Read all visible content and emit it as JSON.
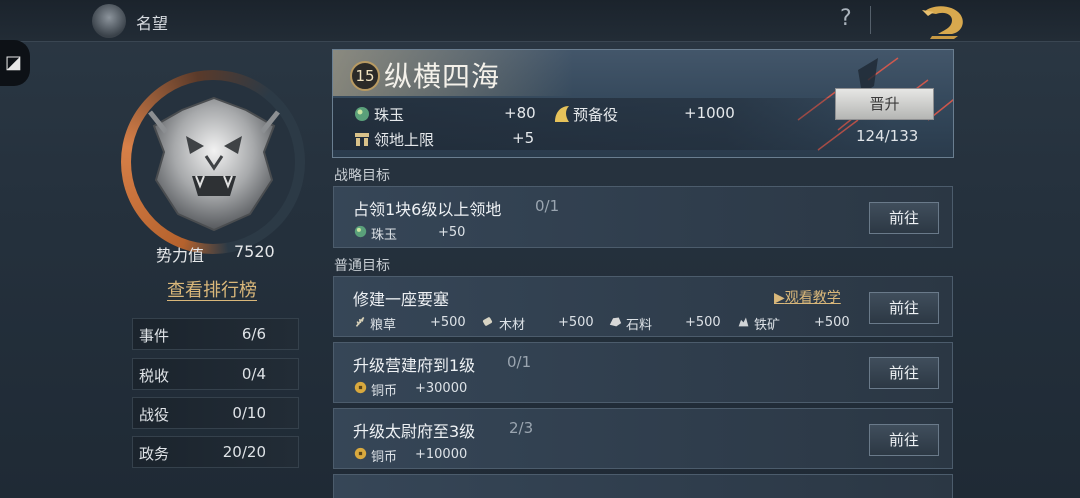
{
  "header": {
    "title": "名望",
    "help_symbol": "?"
  },
  "profile": {
    "power_label": "势力值",
    "power_value": "7520",
    "ranking_link": "查看排行榜",
    "stats": [
      {
        "label": "事件",
        "value": "6/6"
      },
      {
        "label": "税收",
        "value": "0/4"
      },
      {
        "label": "战役",
        "value": "0/10"
      },
      {
        "label": "政务",
        "value": "20/20"
      }
    ]
  },
  "rank": {
    "level": "15",
    "title": "纵横四海",
    "rewards": [
      {
        "icon": "jade-icon",
        "label": "珠玉",
        "value": "+80"
      },
      {
        "icon": "reserve-troops-icon",
        "label": "预备役",
        "value": "+1000"
      },
      {
        "icon": "territory-icon",
        "label": "领地上限",
        "value": "+5"
      }
    ],
    "promote_label": "晋升",
    "progress": "124/133"
  },
  "strategic": {
    "section_title": "战略目标",
    "tasks": [
      {
        "name": "占领1块6级以上领地",
        "count": "0/1",
        "rewards": [
          {
            "icon": "jade-icon",
            "label": "珠玉",
            "value": "+50"
          }
        ],
        "go_label": "前往"
      }
    ]
  },
  "normal": {
    "section_title": "普通目标",
    "tutorial_label": "观看教学",
    "tasks": [
      {
        "name": "修建一座要塞",
        "count": "",
        "rewards": [
          {
            "icon": "grain-icon",
            "label": "粮草",
            "value": "+500"
          },
          {
            "icon": "wood-icon",
            "label": "木材",
            "value": "+500"
          },
          {
            "icon": "stone-icon",
            "label": "石料",
            "value": "+500"
          },
          {
            "icon": "iron-icon",
            "label": "铁矿",
            "value": "+500"
          }
        ],
        "go_label": "前往"
      },
      {
        "name": "升级营建府到1级",
        "count": "0/1",
        "rewards": [
          {
            "icon": "copper-coin-icon",
            "label": "铜币",
            "value": "+30000"
          }
        ],
        "go_label": "前往"
      },
      {
        "name": "升级太尉府至3级",
        "count": "2/3",
        "rewards": [
          {
            "icon": "copper-coin-icon",
            "label": "铜币",
            "value": "+10000"
          }
        ],
        "go_label": "前往"
      }
    ]
  },
  "colors": {
    "accent_gold": "#d9b77a",
    "panel": "#2f3d4c"
  }
}
